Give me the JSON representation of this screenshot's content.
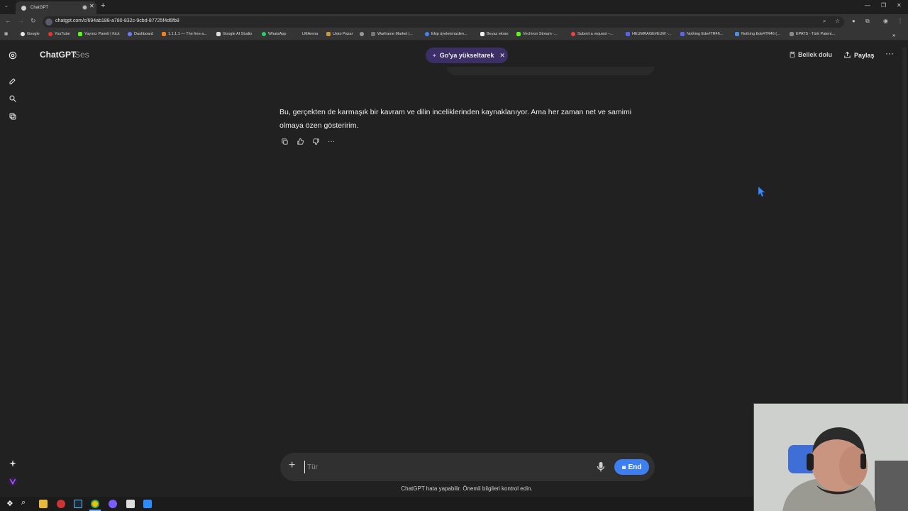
{
  "browser": {
    "tab_title": "ChatGPT",
    "url": "chatgpt.com/c/694ab188-a780-832c-9cbd-87725f4d6fb8",
    "bookmarks": [
      "Google",
      "YouTube",
      "Yayıncı Paneli | Kick",
      "Dashboard",
      "1.1.1.1 — The free a...",
      "Google AI Studio",
      "WhatsApp",
      "LMArena",
      "Uskо Pazar",
      "Warframe Market |...",
      "Ekip üyelerimizden...",
      "Beyaz ekran",
      "Vechiron Stream -...",
      "Submit a request –...",
      "HEUMRAGE#EUW -...",
      "Nothing Ede#TR46...",
      "Nothing Ede#TR46 (...",
      "EPATS - Türk Patent..."
    ]
  },
  "header": {
    "title": "ChatGPT",
    "mode": "Ses",
    "upgrade_pill": "Go'ya yükseltarek",
    "memory_label": "Bellek dolu",
    "share_label": "Paylaş"
  },
  "conversation": {
    "assistant_message": "Bu, gerçekten de karmaşık bir kavram ve dilin inceliklerinden kaynaklanıyor. Ama her zaman net ve samimi olmaya özen gösteririm."
  },
  "composer": {
    "placeholder": "Tür",
    "end_label": "End"
  },
  "footer": {
    "disclaimer": "ChatGPT hata yapabilir. Önemli bilgileri kontrol edin."
  },
  "icons": {
    "accent": "#3d7ff0",
    "pill_bg": "#3b2f66"
  }
}
